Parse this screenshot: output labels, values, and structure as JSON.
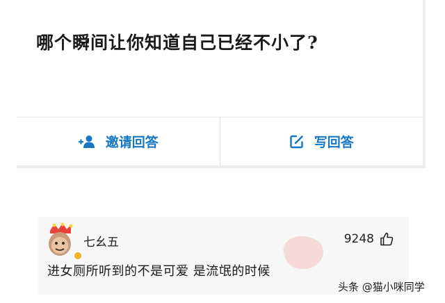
{
  "question": {
    "title": "哪个瞬间让你知道自己已经不小了?"
  },
  "actions": {
    "invite_label": "邀请回答",
    "invite_icon": "add-user-icon",
    "write_label": "写回答",
    "write_icon": "edit-icon"
  },
  "answer": {
    "username": "七幺五",
    "likes": "9248",
    "like_icon": "thumbs-up-icon",
    "text": "进女厕所听到的不是可爱 是流氓的时候"
  },
  "watermark": {
    "attribution": "头条 @猫小咪同学"
  },
  "colors": {
    "accent": "#1677c4",
    "answer_bg": "#f7f7f7",
    "verified_badge": "#f2b21c"
  }
}
